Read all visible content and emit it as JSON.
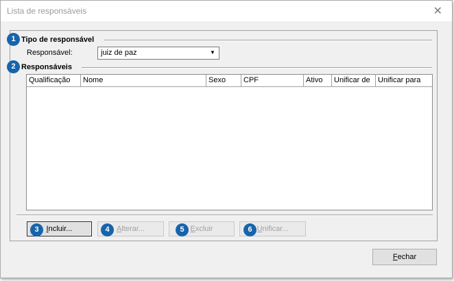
{
  "window": {
    "title": "Lista de responsáveis",
    "close_glyph": "✕"
  },
  "sections": {
    "tipo": {
      "badge": "1",
      "title": "Tipo de responsável"
    },
    "responsaveis": {
      "badge": "2",
      "title": "Responsáveis"
    }
  },
  "form": {
    "responsavel_label": "Responsável:",
    "responsavel_value": "juiz de paz"
  },
  "grid": {
    "columns": [
      "Qualificação",
      "Nome",
      "Sexo",
      "CPF",
      "Ativo",
      "Unificar de",
      "Unificar para"
    ],
    "rows": []
  },
  "buttons": {
    "incluir": {
      "badge": "3",
      "mnemonic": "I",
      "rest": "ncluir..."
    },
    "alterar": {
      "badge": "4",
      "mnemonic": "A",
      "rest": "lterar..."
    },
    "excluir": {
      "badge": "5",
      "mnemonic": "E",
      "rest": "xcluir"
    },
    "unificar": {
      "badge": "6",
      "mnemonic": "U",
      "rest": "nificar..."
    },
    "fechar": {
      "mnemonic": "F",
      "rest": "echar"
    }
  },
  "colors": {
    "badge": "#1664ac",
    "window_bg": "#f0f0f0",
    "disabled_text": "#a0a0a0"
  }
}
